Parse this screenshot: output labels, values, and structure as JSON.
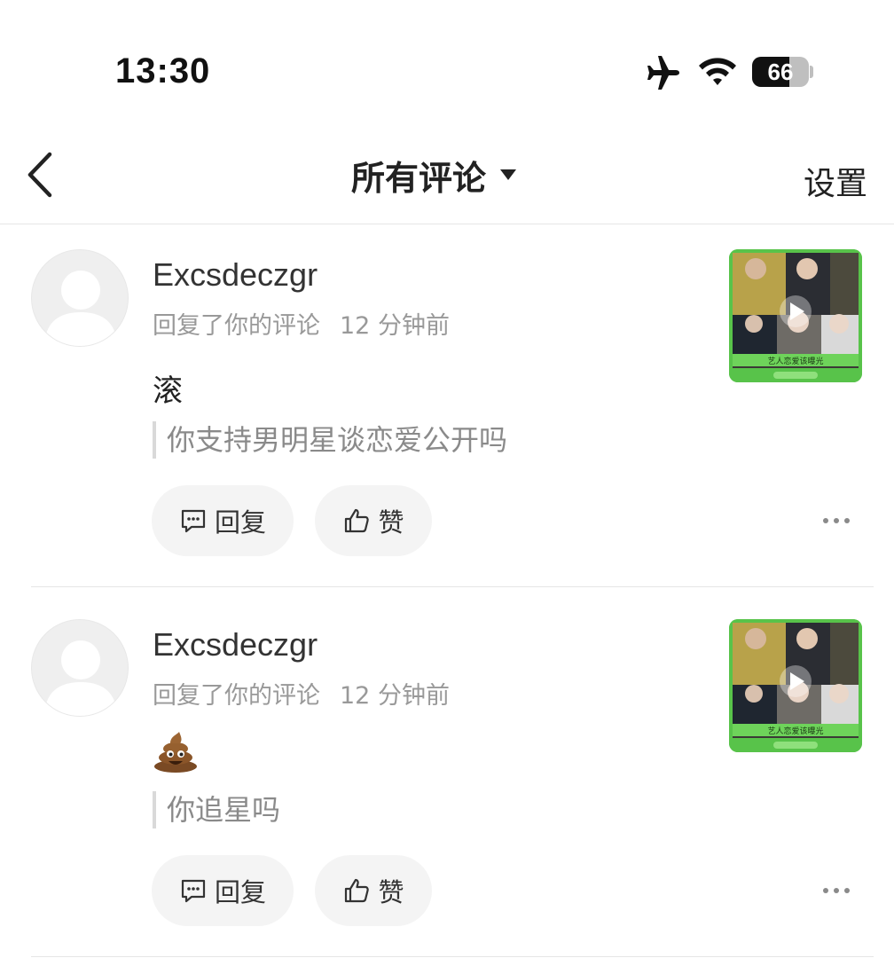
{
  "status_bar": {
    "time": "13:30",
    "battery": "66",
    "battery_level_percent": 66,
    "icons": [
      "airplane-icon",
      "wifi-icon",
      "battery-icon"
    ]
  },
  "nav": {
    "back_icon": "chevron-left-icon",
    "title": "所有评论",
    "dropdown_icon": "caret-down-icon",
    "settings": "设置"
  },
  "comments": [
    {
      "username": "Excsdeczgr",
      "action": "回复了你的评论",
      "time": "12 分钟前",
      "content": "滚",
      "quote": "你支持男明星谈恋爱公开吗",
      "reply_label": "回复",
      "like_label": "赞",
      "thumbnail_caption": "艺人恋爱该曝光"
    },
    {
      "username": "Excsdeczgr",
      "action": "回复了你的评论",
      "time": "12 分钟前",
      "content_emoji": "poop-emoji",
      "quote": "你追星吗",
      "reply_label": "回复",
      "like_label": "赞",
      "thumbnail_caption": "艺人恋爱该曝光"
    }
  ],
  "colors": {
    "thumbnail_border": "#58c34a",
    "button_bg": "#f4f4f4",
    "meta_text": "#999999"
  }
}
